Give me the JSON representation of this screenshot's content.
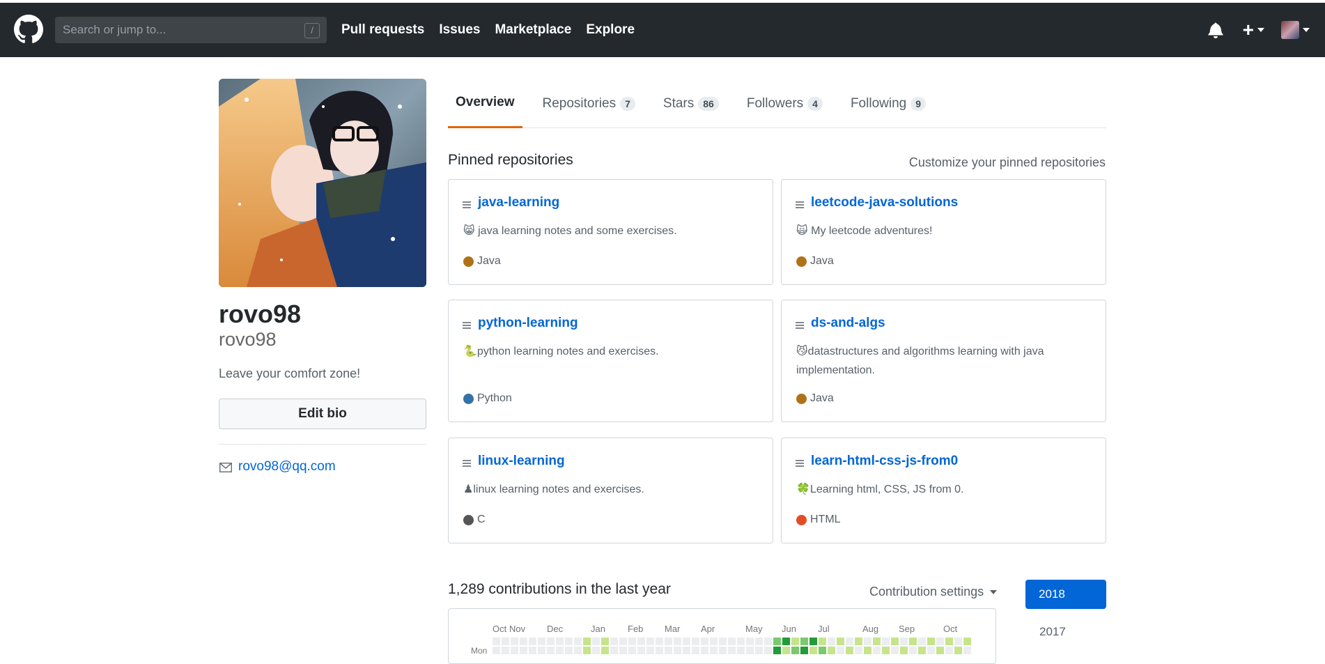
{
  "header": {
    "search_placeholder": "Search or jump to...",
    "search_hotkey": "/",
    "nav": [
      "Pull requests",
      "Issues",
      "Marketplace",
      "Explore"
    ],
    "plus_label": "+"
  },
  "profile": {
    "name": "rovo98",
    "username": "rovo98",
    "bio": "Leave your comfort zone!",
    "edit_bio_label": "Edit bio",
    "email": "rovo98@qq.com"
  },
  "tabs": [
    {
      "label": "Overview",
      "count": null,
      "active": true
    },
    {
      "label": "Repositories",
      "count": "7",
      "active": false
    },
    {
      "label": "Stars",
      "count": "86",
      "active": false
    },
    {
      "label": "Followers",
      "count": "4",
      "active": false
    },
    {
      "label": "Following",
      "count": "9",
      "active": false
    }
  ],
  "pinned": {
    "title": "Pinned repositories",
    "customize_label": "Customize your pinned repositories",
    "repos": [
      {
        "name": "java-learning",
        "description": "😸 java learning notes and some exercises.",
        "language": "Java",
        "color": "#b07219"
      },
      {
        "name": "leetcode-java-solutions",
        "description": "🙀 My leetcode adventures!",
        "language": "Java",
        "color": "#b07219"
      },
      {
        "name": "python-learning",
        "description": "🐍python learning notes and exercises.",
        "language": "Python",
        "color": "#3572a5"
      },
      {
        "name": "ds-and-algs",
        "description": "😼datastructures and algorithms learning with java implementation.",
        "language": "Java",
        "color": "#b07219"
      },
      {
        "name": "linux-learning",
        "description": "♟linux learning notes and exercises.",
        "language": "C",
        "color": "#555555"
      },
      {
        "name": "learn-html-css-js-from0",
        "description": "🍀Learning html, CSS, JS from 0.",
        "language": "HTML",
        "color": "#e34c26"
      }
    ]
  },
  "contributions": {
    "title": "1,289 contributions in the last year",
    "settings_label": "Contribution settings",
    "months": [
      "Oct",
      "Nov",
      "Dec",
      "Jan",
      "Feb",
      "Mar",
      "Apr",
      "May",
      "Jun",
      "Jul",
      "Aug",
      "Sep",
      "Oct"
    ],
    "day_label": "Mon",
    "years": [
      "2018",
      "2017"
    ],
    "active_year": "2018",
    "palette": [
      "#ebedf0",
      "#c6e48b",
      "#7bc96f",
      "#239a3b",
      "#196127"
    ]
  }
}
